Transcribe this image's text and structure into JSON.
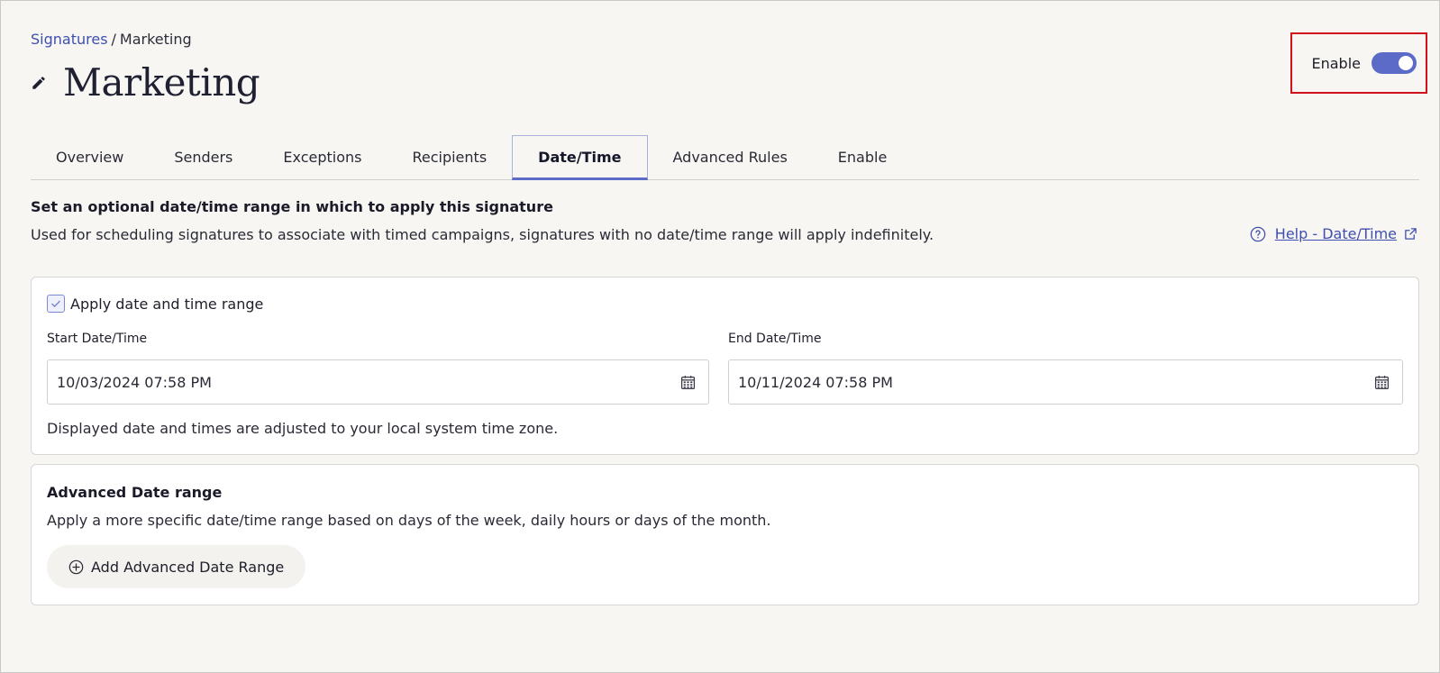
{
  "breadcrumb": {
    "root": "Signatures",
    "separator": "/",
    "current": "Marketing"
  },
  "header": {
    "title": "Marketing",
    "edit_icon": "pencil-icon",
    "enable_label": "Enable",
    "enabled": true
  },
  "tabs": [
    {
      "label": "Overview",
      "active": false
    },
    {
      "label": "Senders",
      "active": false
    },
    {
      "label": "Exceptions",
      "active": false
    },
    {
      "label": "Recipients",
      "active": false
    },
    {
      "label": "Date/Time",
      "active": true
    },
    {
      "label": "Advanced Rules",
      "active": false
    },
    {
      "label": "Enable",
      "active": false
    }
  ],
  "intro": {
    "heading": "Set an optional date/time range in which to apply this signature",
    "description": "Used for scheduling signatures to associate with timed campaigns, signatures with no date/time range will apply indefinitely.",
    "help_link": "Help - Date/Time"
  },
  "date_range": {
    "apply_label": "Apply date and time range",
    "apply_checked": true,
    "start_label": "Start Date/Time",
    "start_value": "10/03/2024 07:58 PM",
    "end_label": "End Date/Time",
    "end_value": "10/11/2024 07:58 PM",
    "timezone_note": "Displayed date and times are adjusted to your local system time zone."
  },
  "advanced": {
    "heading": "Advanced Date range",
    "description": "Apply a more specific date/time range based on days of the week, daily hours or days of the month.",
    "add_button": "Add Advanced Date Range"
  },
  "colors": {
    "accent": "#5b6bc7",
    "link": "#3f4fb0",
    "highlight_border": "#d0101b",
    "background": "#f7f6f3"
  }
}
